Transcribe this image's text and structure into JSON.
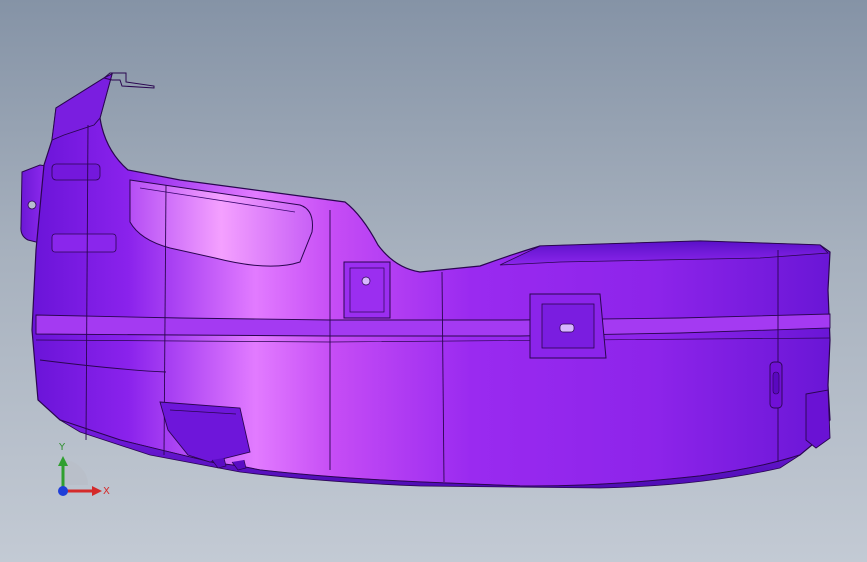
{
  "view": {
    "background_colors": [
      "#8593a6",
      "#c3cad4"
    ],
    "part_color": "#9b26f2",
    "edge_color": "#2a0650",
    "highlight_color": "#f08cff"
  },
  "triad": {
    "x_label": "X",
    "y_label": "Y",
    "x_color": "#d42a2a",
    "y_color": "#2f9f2f",
    "z_color": "#1f3fd8"
  }
}
